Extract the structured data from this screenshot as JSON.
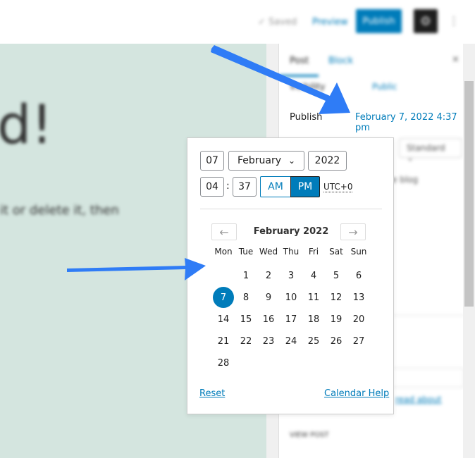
{
  "topbar": {
    "saved": "Saved",
    "preview": "Preview",
    "publish": "Publish"
  },
  "editor": {
    "heading_fragment": "d!",
    "text_fragment": "it or delete it, then"
  },
  "sidebar": {
    "tabs": [
      "Post",
      "Block"
    ],
    "visibility_label": "Visibility",
    "visibility_value": "Public",
    "publish_label": "Publish",
    "publish_value": "February 7, 2022 4:37 pm",
    "format_value": "Standard",
    "blog_fragment": "e blog",
    "read_about": "read about",
    "view_post": "VIEW POST"
  },
  "picker": {
    "day": "07",
    "month": "February",
    "year": "2022",
    "hour": "04",
    "minute": "37",
    "am": "AM",
    "pm": "PM",
    "timezone": "UTC+0",
    "selected_meridiem": "PM",
    "calendar_title": "February 2022",
    "weekdays": [
      "Mon",
      "Tue",
      "Wed",
      "Thu",
      "Fri",
      "Sat",
      "Sun"
    ],
    "first_weekday_index": 1,
    "days_in_month": 28,
    "selected_day": 7,
    "reset": "Reset",
    "help": "Calendar Help"
  },
  "colors": {
    "accent": "#007cba",
    "arrow": "#2f7cf6",
    "editor_bg": "#d4e5df"
  },
  "icons": [
    "check-icon",
    "chevron-down-icon",
    "arrow-left-icon",
    "arrow-right-icon",
    "gear-icon",
    "more-vertical-icon",
    "close-icon"
  ]
}
